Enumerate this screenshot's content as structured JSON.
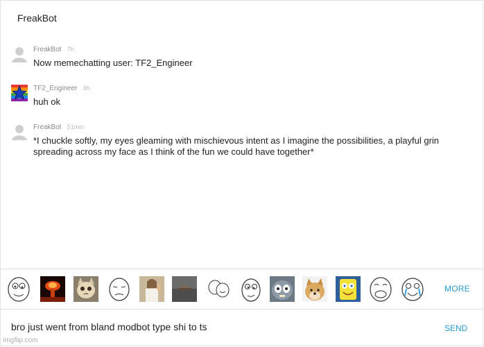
{
  "header": {
    "title": "FreakBot"
  },
  "messages": [
    {
      "author": "FreakBot",
      "time": "7h",
      "text": "Now memechatting user: TF2_Engineer",
      "avatar": "default-user-icon"
    },
    {
      "author": "TF2_Engineer",
      "time": "4h",
      "text": "huh ok",
      "avatar": "rainbow-star-icon"
    },
    {
      "author": "FreakBot",
      "time": "51min",
      "text": "*I chuckle softly, my eyes gleaming with mischievous intent as I imagine the possibilities, a playful grin spreading across my face as I think of the fun we could have together*",
      "avatar": "default-user-icon"
    }
  ],
  "meme_tray": {
    "items": [
      "derp-face",
      "nuclear-explosion",
      "crying-cat",
      "okay-guy-face",
      "buddy-christ",
      "scumbag-hat",
      "friendship-ended-faces",
      "derp-face-2",
      "scared-tom-cat",
      "doge",
      "imagination-spongebob",
      "yao-ming-laugh",
      "happy-cry-face"
    ],
    "more_label": "MORE"
  },
  "composer": {
    "value": "bro just went from bland modbot type shi to ts",
    "send_label": "SEND"
  },
  "watermark": "imgflip.com",
  "colors": {
    "accent": "#2a9bd4",
    "meta": "#8a8a8a",
    "divider": "#dedede"
  }
}
